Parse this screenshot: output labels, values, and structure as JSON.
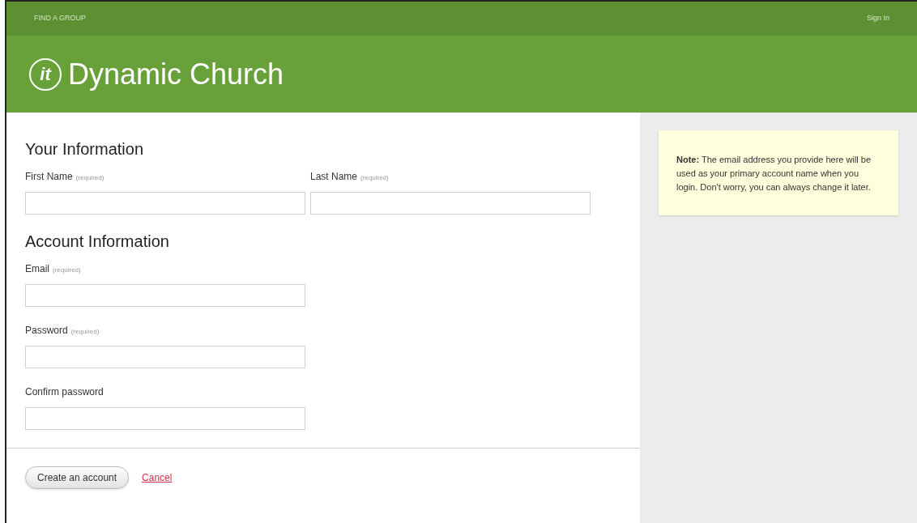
{
  "top_bar": {
    "link": "FIND A GROUP",
    "sign_in": "Sign In"
  },
  "header": {
    "logo_mark": "it",
    "site_name": "Dynamic Church"
  },
  "sections": [
    {
      "title": "Your Information",
      "kind": "row",
      "fields": [
        {
          "label": "First Name",
          "hint": "(required)"
        },
        {
          "label": "Last Name",
          "hint": "(required)"
        }
      ]
    },
    {
      "title": "Account Information",
      "kind": "stacked",
      "fields": [
        {
          "label": "Email",
          "hint": "(required)"
        },
        {
          "label": "Password",
          "hint": "(required)"
        },
        {
          "label": "Confirm password"
        }
      ]
    }
  ],
  "actions": {
    "submit": "Create an account",
    "cancel": "Cancel"
  },
  "note": "**Note:** The email address you provide here will be used as your primary account name when you login. Don't worry, you can always change it later."
}
